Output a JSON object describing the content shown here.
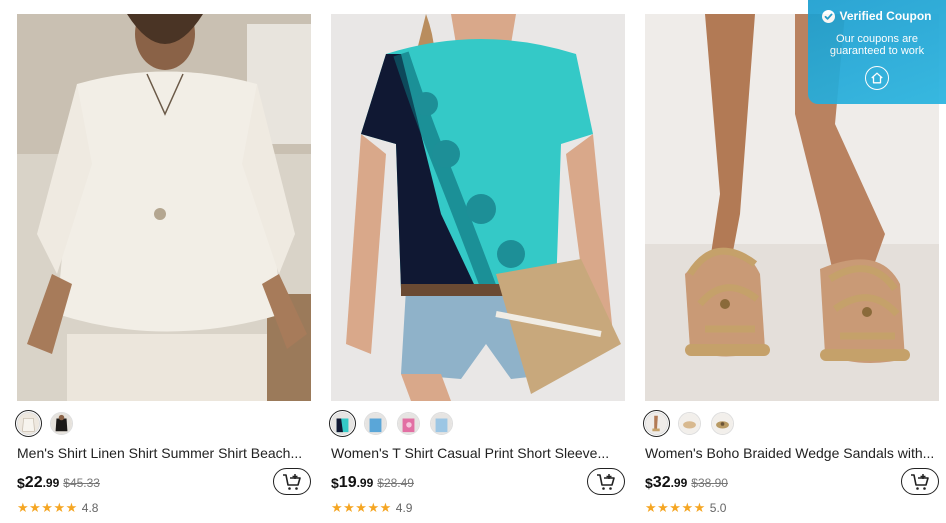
{
  "products": [
    {
      "title": "Men's Shirt Linen Shirt Summer Shirt Beach...",
      "currency": "$",
      "price_int": "22",
      "price_dec": ".99",
      "old_price": "$45.33",
      "stars": "★★★★★",
      "rating": "4.8",
      "swatches": [
        "swatch-white-shirt",
        "swatch-black-shirt"
      ]
    },
    {
      "title": "Women's T Shirt Casual Print Short Sleeve...",
      "currency": "$",
      "price_int": "19",
      "price_dec": ".99",
      "old_price": "$28.49",
      "stars": "★★★★★",
      "rating": "4.9",
      "swatches": [
        "swatch-teal",
        "swatch-blue",
        "swatch-pink",
        "swatch-light-blue"
      ]
    },
    {
      "title": "Women's Boho Braided Wedge Sandals with...",
      "currency": "$",
      "price_int": "32",
      "price_dec": ".99",
      "old_price": "$38.90",
      "stars": "★★★★★",
      "rating": "5.0",
      "swatches": [
        "swatch-tan",
        "swatch-beige",
        "swatch-gold"
      ]
    }
  ],
  "coupon": {
    "title": "Verified Coupon",
    "line1": "Our coupons are",
    "line2": "guaranteed to work"
  },
  "colors": {
    "accent_blue": "#1d9fd0",
    "star": "#f5a623",
    "price": "#111111"
  },
  "icons": {
    "cart": "cart-add-icon",
    "coupon_check": "check-circle-icon",
    "coupon_home": "home-icon"
  }
}
